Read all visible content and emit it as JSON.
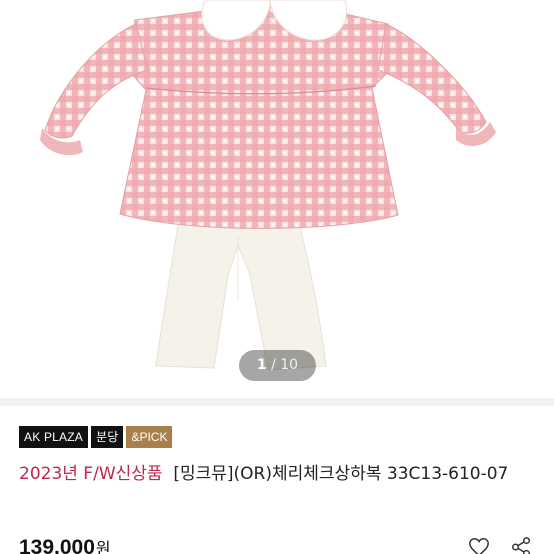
{
  "gallery": {
    "current": "1",
    "separator": " / ",
    "total": "10"
  },
  "badges": [
    {
      "label": "AK PLAZA",
      "color": "#111111"
    },
    {
      "label": "분당",
      "color": "#111111"
    },
    {
      "label": "&PICK",
      "color": "#a9804c"
    }
  ],
  "product": {
    "promo": "2023년 F/W신상품",
    "name": "[밍크뮤](OR)체리체크상하복 33C13-610-07",
    "price": "139,000",
    "currency": "원"
  },
  "actions": [
    {
      "icon": "heart-icon"
    },
    {
      "icon": "share-icon"
    }
  ],
  "colors": {
    "promo": "#c2264f",
    "check_pink": "#e58f97",
    "leggings": "#f4f1e8"
  }
}
